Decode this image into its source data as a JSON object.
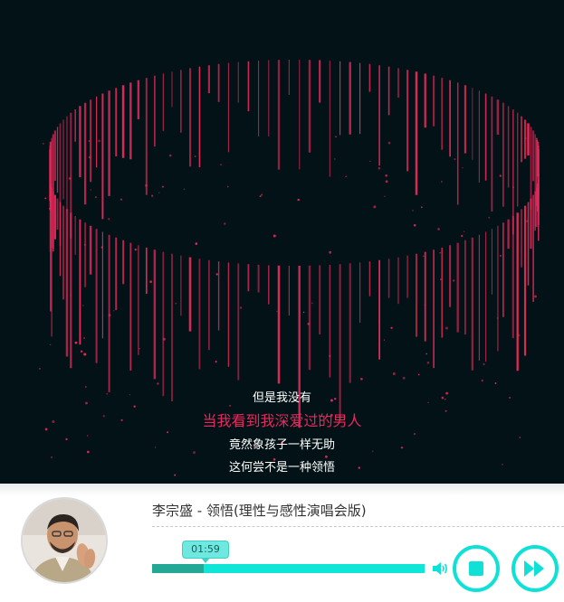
{
  "lyrics": {
    "lines": [
      "但是我没有",
      "当我看到我深爱过的男人",
      "竟然象孩子一样无助",
      "这何尝不是一种领悟"
    ],
    "active_index": 1
  },
  "player": {
    "song_title": "李宗盛 - 领悟(理性与感性演唱会版)",
    "current_time": "01:59",
    "progress": 0.19
  },
  "icons": {
    "volume": "volume-icon",
    "stop": "stop-icon",
    "next": "fast-forward-icon",
    "avatar": "artist-avatar"
  },
  "colors": {
    "background": "#031216",
    "visualizer": "#e8295b",
    "accent": "#10e1d6",
    "progress_played": "#23a896"
  }
}
